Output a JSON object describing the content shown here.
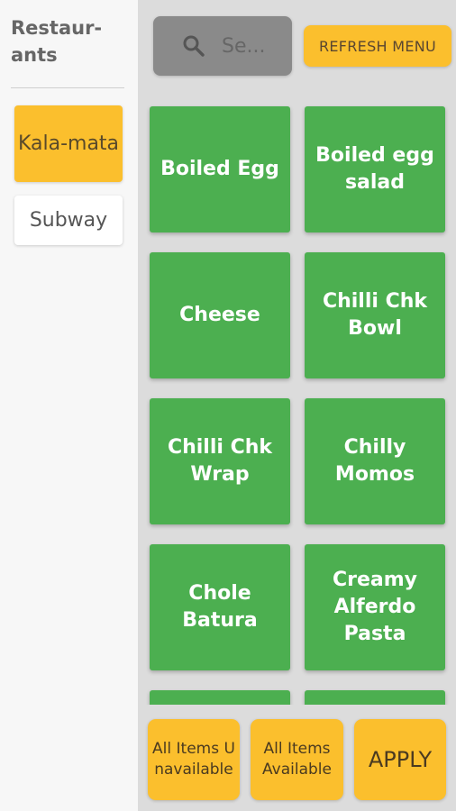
{
  "sidebar": {
    "title": "Restaur-ants",
    "restaurants": [
      {
        "label": "Kala-mata",
        "active": true
      },
      {
        "label": "Subway",
        "active": false
      }
    ]
  },
  "toolbar": {
    "search_placeholder": "Se...",
    "refresh_label": "REFRESH MENU"
  },
  "menu_items": [
    {
      "label": "Boiled Egg"
    },
    {
      "label": "Boiled egg salad"
    },
    {
      "label": "Cheese"
    },
    {
      "label": "Chilli Chk Bowl"
    },
    {
      "label": "Chilli Chk Wrap"
    },
    {
      "label": "Chilly Momos"
    },
    {
      "label": "Chole Batura"
    },
    {
      "label": "Creamy Alferdo Pasta"
    },
    {
      "label": ""
    },
    {
      "label": ""
    }
  ],
  "actions": {
    "all_unavailable_label": "All Items Unavailable",
    "all_available_label": "All Items Available",
    "apply_label": "APPLY"
  },
  "colors": {
    "accent": "#fbbf2d",
    "card": "#4caf50",
    "search_bg": "#8a8a8a"
  }
}
